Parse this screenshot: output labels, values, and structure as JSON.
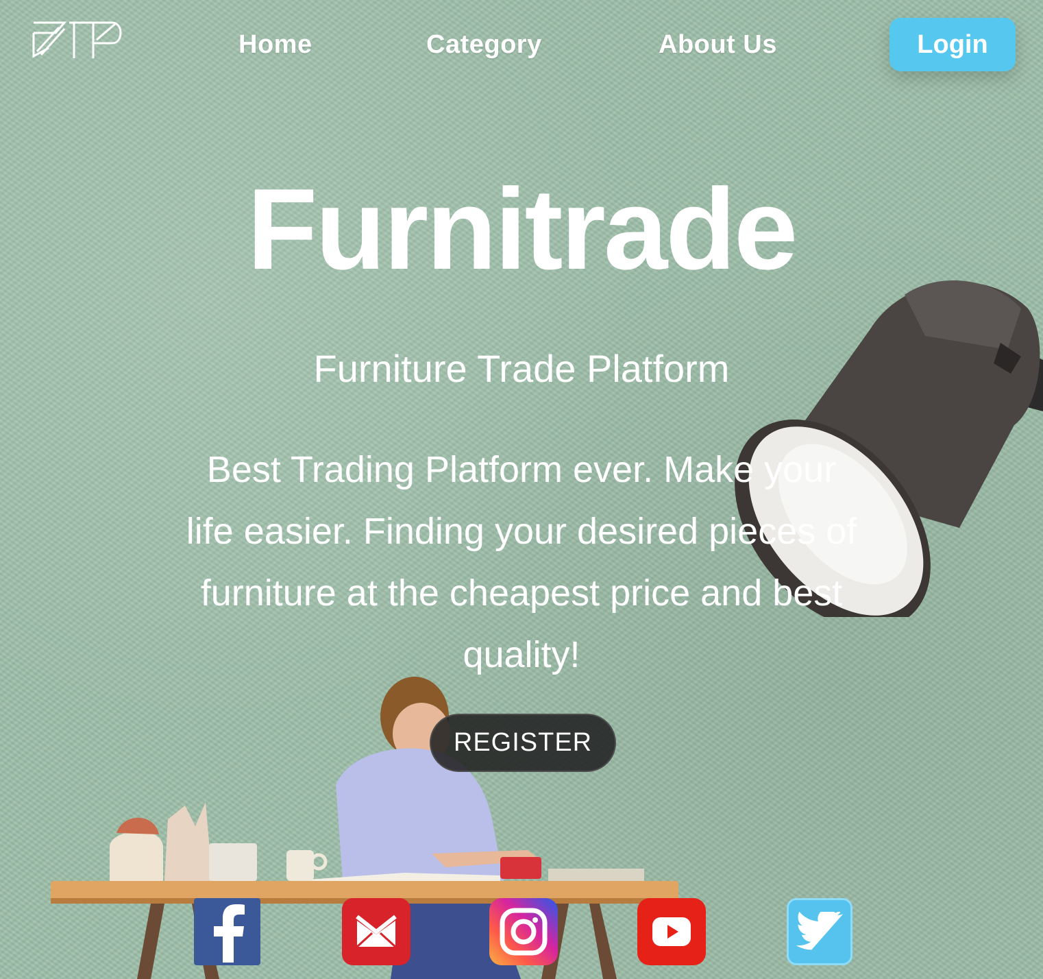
{
  "nav": {
    "logo_text": "FTP",
    "links": [
      {
        "label": "Home"
      },
      {
        "label": "Category"
      },
      {
        "label": "About Us"
      }
    ],
    "login_label": "Login"
  },
  "hero": {
    "title": "Furnitrade",
    "tagline": "Furniture Trade Platform",
    "description": "Best Trading Platform ever. Make your life easier. Finding your desired pieces of furniture at the cheapest price and best quality!",
    "register_label": "REGISTER"
  },
  "social": [
    {
      "name": "facebook",
      "icon": "facebook-icon",
      "color": "#3b5998"
    },
    {
      "name": "gmail",
      "icon": "gmail-icon",
      "color": "#d8232a"
    },
    {
      "name": "instagram",
      "icon": "instagram-icon",
      "color": "#d6249f"
    },
    {
      "name": "youtube",
      "icon": "youtube-icon",
      "color": "#e62117"
    },
    {
      "name": "twitter",
      "icon": "twitter-icon",
      "color": "#55c3ee"
    }
  ],
  "colors": {
    "background": "#9dbea9",
    "accent": "#56c7ee",
    "register_bg": "#222222"
  }
}
